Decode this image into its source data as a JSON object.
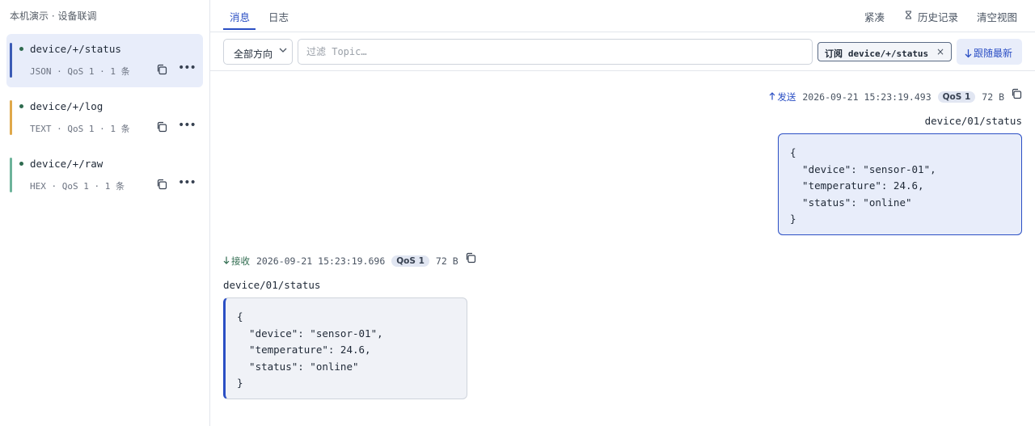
{
  "sidebar": {
    "title": "本机演示 · 设备联调",
    "subscriptions": [
      {
        "topic": "device/+/status",
        "meta": "JSON · QoS 1 · 1 条",
        "color": "#3b5bb5",
        "active": true
      },
      {
        "topic": "device/+/log",
        "meta": "TEXT · QoS 1 · 1 条",
        "color": "#e0a84a",
        "active": false
      },
      {
        "topic": "device/+/raw",
        "meta": "HEX · QoS 1 · 1 条",
        "color": "#6db39a",
        "active": false
      }
    ],
    "icons": {
      "copy": "copy-icon",
      "more": "more-icon",
      "status_dot": "status-dot-icon"
    }
  },
  "header": {
    "tabs": [
      {
        "label": "消息",
        "active": true
      },
      {
        "label": "日志",
        "active": false
      }
    ],
    "compact_label": "紧凑",
    "history_label": "历史记录",
    "history_icon": "history-icon",
    "clear_label": "清空视图"
  },
  "filter": {
    "direction_value": "全部方向",
    "topic_placeholder": "过滤 Topic…",
    "subscribe_chip_prefix": "订阅",
    "subscribe_chip_topic": "device/+/status",
    "subscribe_chip_close": "×",
    "follow_label": "跟随最新"
  },
  "messages": [
    {
      "direction": "out",
      "direction_label": "发送",
      "timestamp": "2026-09-21 15:23:19.493",
      "qos": "QoS 1",
      "size": "72 B",
      "topic": "device/01/status",
      "payload": "{\n  \"device\": \"sensor-01\",\n  \"temperature\": 24.6,\n  \"status\": \"online\"\n}"
    },
    {
      "direction": "in",
      "direction_label": "接收",
      "timestamp": "2026-09-21 15:23:19.696",
      "qos": "QoS 1",
      "size": "72 B",
      "topic": "device/01/status",
      "payload": "{\n  \"device\": \"sensor-01\",\n  \"temperature\": 24.6,\n  \"status\": \"online\"\n}"
    }
  ],
  "colors": {
    "accent": "#2b4fc4",
    "receive": "#2f6b4f",
    "active_bg": "#e8edfa"
  }
}
